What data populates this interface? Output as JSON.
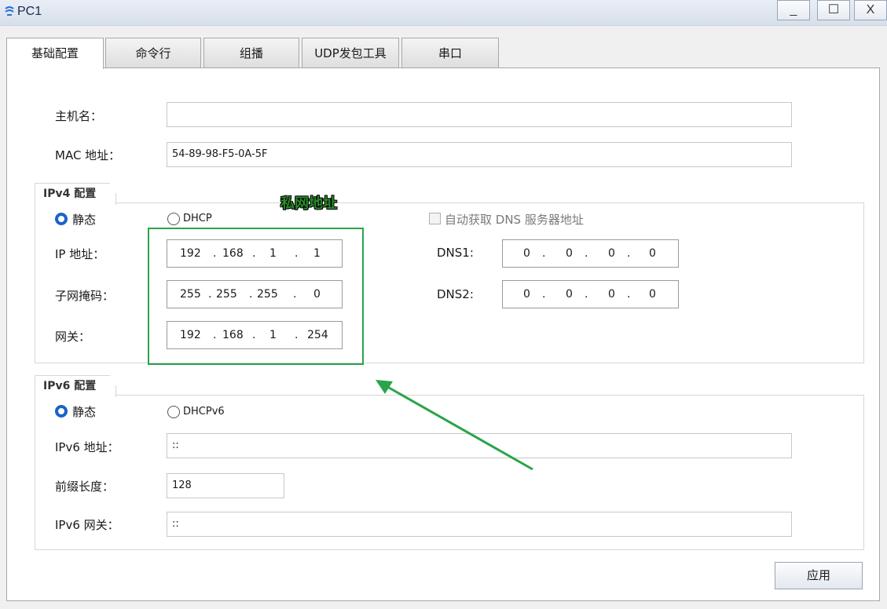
{
  "window": {
    "title": "PC1",
    "minimize": "_",
    "maximize": "☐",
    "close": "X"
  },
  "tabs": [
    "基础配置",
    "命令行",
    "组播",
    "UDP发包工具",
    "串口"
  ],
  "basic": {
    "hostname_label": "主机名：",
    "hostname_value": "",
    "mac_label": "MAC 地址：",
    "mac_value": "54-89-98-F5-0A-5F"
  },
  "ipv4": {
    "group_title": "IPv4 配置",
    "static_label": "静态",
    "dhcp_label": "DHCP",
    "mode": "static",
    "auto_dns_label": "自动获取 DNS 服务器地址",
    "ip_label": "IP 地址：",
    "ip": [
      "192",
      "168",
      "1",
      "1"
    ],
    "mask_label": "子网掩码：",
    "mask": [
      "255",
      "255",
      "255",
      "0"
    ],
    "gateway_label": "网关：",
    "gateway": [
      "192",
      "168",
      "1",
      "254"
    ],
    "dns1_label": "DNS1:",
    "dns1": [
      "0",
      "0",
      "0",
      "0"
    ],
    "dns2_label": "DNS2:",
    "dns2": [
      "0",
      "0",
      "0",
      "0"
    ]
  },
  "ipv6": {
    "group_title": "IPv6 配置",
    "static_label": "静态",
    "dhcp_label": "DHCPv6",
    "addr_label": "IPv6 地址：",
    "addr_value": "::",
    "prefix_label": "前缀长度：",
    "prefix_value": "128",
    "gw_label": "IPv6 网关：",
    "gw_value": "::"
  },
  "annotation": {
    "text": "私网地址",
    "color": "#2aa44a"
  },
  "apply_label": "应用"
}
